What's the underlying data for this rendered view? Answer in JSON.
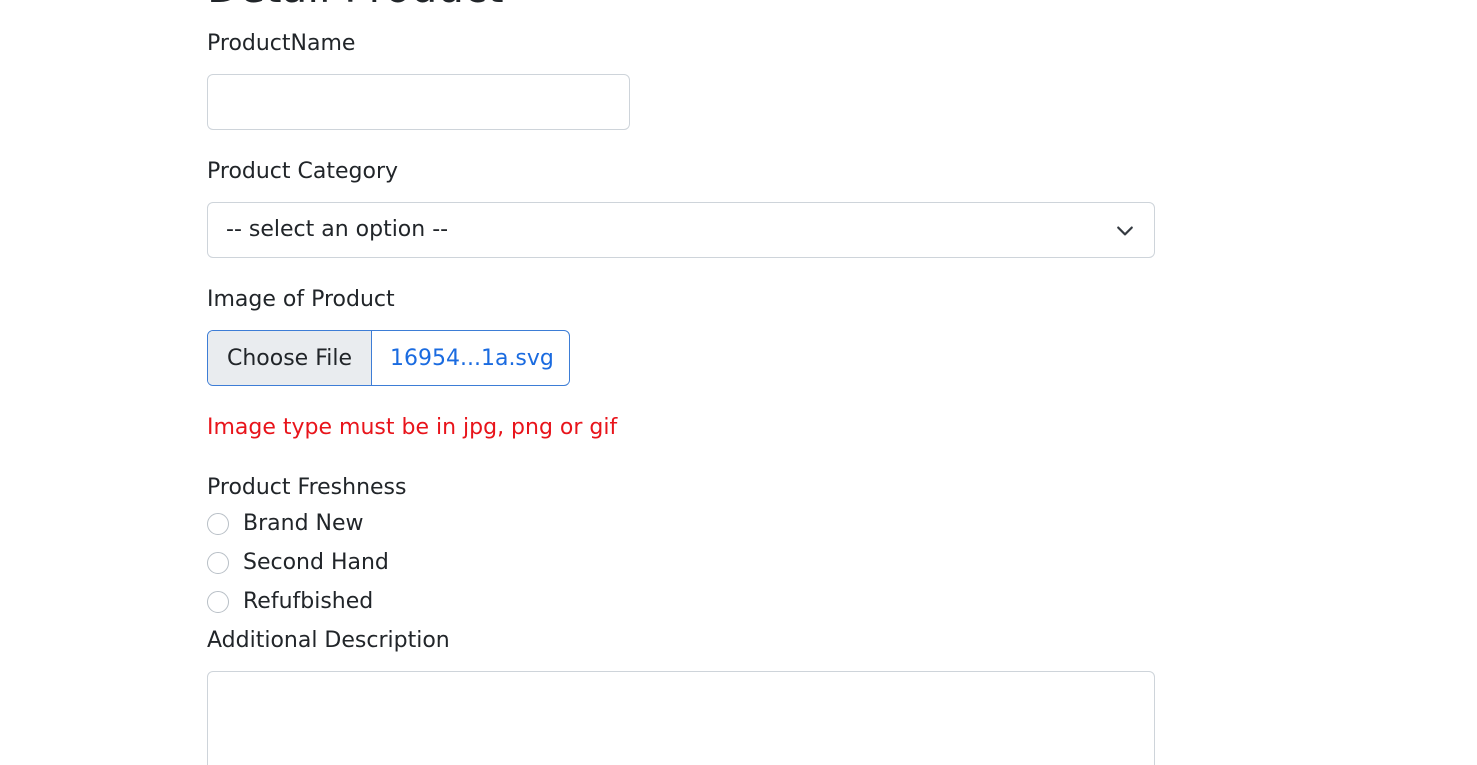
{
  "page": {
    "title": "Detail Product"
  },
  "form": {
    "product_name": {
      "label": "ProductName",
      "value": "",
      "placeholder": ""
    },
    "product_category": {
      "label": "Product Category",
      "selected": "-- select an option --",
      "icon": "chevron-down-icon"
    },
    "product_image": {
      "label": "Image of Product",
      "button_label": "Choose File",
      "file_name": "16954...1a.svg",
      "error": "Image type must be in jpg, png or gif",
      "colors": {
        "border": "#3d7dd6",
        "file_name": "#1a6be0",
        "error": "#e8141b"
      }
    },
    "product_freshness": {
      "label": "Product Freshness",
      "options": [
        {
          "label": "Brand New",
          "checked": false
        },
        {
          "label": "Second Hand",
          "checked": false
        },
        {
          "label": "Refufbished",
          "checked": false
        }
      ]
    },
    "additional_description": {
      "label": "Additional Description",
      "value": ""
    }
  }
}
